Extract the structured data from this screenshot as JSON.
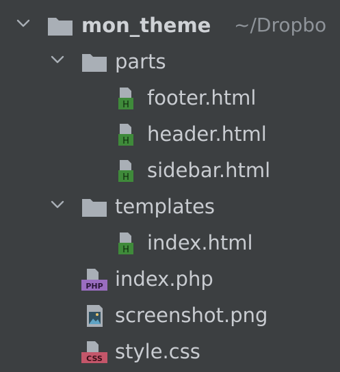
{
  "project_tree": {
    "root": {
      "name": "mon_theme",
      "path": "~/Dropbo",
      "expanded": true,
      "icon": "folder-icon"
    },
    "items": [
      {
        "name": "parts",
        "type": "folder",
        "expanded": true,
        "icon": "folder-icon"
      },
      {
        "name": "footer.html",
        "type": "file",
        "icon": "html-file-icon",
        "badge": "H"
      },
      {
        "name": "header.html",
        "type": "file",
        "icon": "html-file-icon",
        "badge": "H"
      },
      {
        "name": "sidebar.html",
        "type": "file",
        "icon": "html-file-icon",
        "badge": "H"
      },
      {
        "name": "templates",
        "type": "folder",
        "expanded": true,
        "icon": "folder-icon"
      },
      {
        "name": "index.html",
        "type": "file",
        "icon": "html-file-icon",
        "badge": "H"
      },
      {
        "name": "index.php",
        "type": "file",
        "icon": "php-file-icon",
        "badge": "PHP"
      },
      {
        "name": "screenshot.png",
        "type": "file",
        "icon": "image-file-icon"
      },
      {
        "name": "style.css",
        "type": "file",
        "icon": "css-file-icon",
        "badge": "CSS"
      }
    ]
  },
  "colors": {
    "background": "#3c3f41",
    "text": "#c9ccd1",
    "muted_path": "#8f949a",
    "folder": "#a9afb6",
    "html_badge": "#3f8a3a",
    "php_badge": "#9a6dc0",
    "css_badge": "#c4566a"
  }
}
